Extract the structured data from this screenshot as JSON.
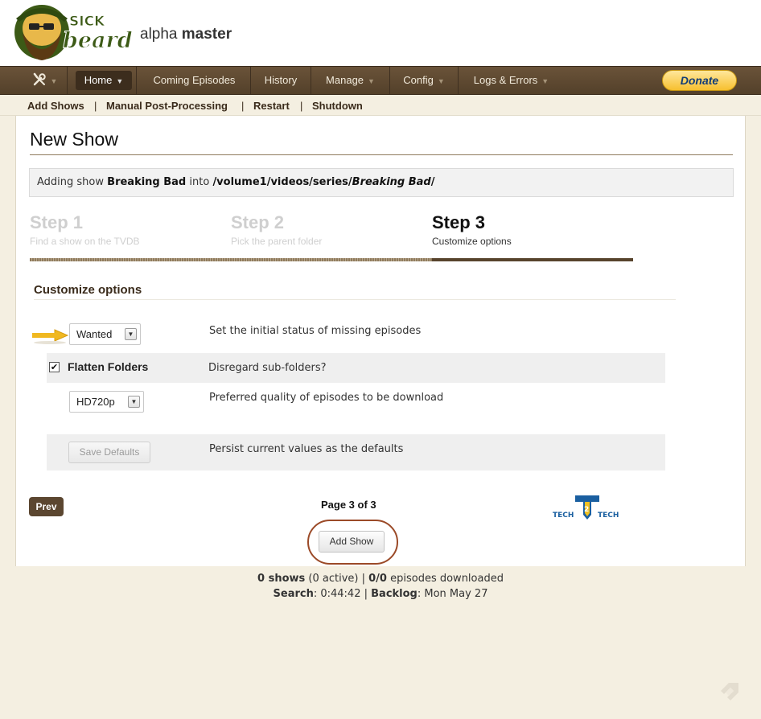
{
  "header": {
    "logo_text": "SICK beard",
    "version_prefix": "alpha",
    "version_branch": "master"
  },
  "nav": {
    "tools_icon": "wrench-screwdriver-icon",
    "items": [
      {
        "label": "Home",
        "has_dropdown": true,
        "active": true
      },
      {
        "label": "Coming Episodes",
        "has_dropdown": false
      },
      {
        "label": "History",
        "has_dropdown": false
      },
      {
        "label": "Manage",
        "has_dropdown": true
      },
      {
        "label": "Config",
        "has_dropdown": true
      },
      {
        "label": "Logs & Errors",
        "has_dropdown": true
      }
    ],
    "donate_label": "Donate"
  },
  "submenu": {
    "items": [
      "Add Shows",
      "Manual Post-Processing",
      "Restart",
      "Shutdown"
    ],
    "separator": "|"
  },
  "page": {
    "title": "New Show",
    "adding": {
      "prefix": "Adding show",
      "show_name": "Breaking Bad",
      "middle": "into",
      "path_base": "/volume1/videos/series/",
      "path_show": "Breaking Bad",
      "path_end": "/"
    },
    "steps": [
      {
        "title": "Step 1",
        "desc": "Find a show on the TVDB",
        "active": false
      },
      {
        "title": "Step 2",
        "desc": "Pick the parent folder",
        "active": false
      },
      {
        "title": "Step 3",
        "desc": "Customize options",
        "active": true
      }
    ],
    "section_title": "Customize options",
    "options": {
      "status": {
        "value": "Wanted",
        "desc": "Set the initial status of missing episodes"
      },
      "flatten": {
        "label": "Flatten Folders",
        "checked": true,
        "check_mark": "✔",
        "desc": "Disregard sub-folders?"
      },
      "quality": {
        "value": "HD720p",
        "desc": "Preferred quality of episodes to be download"
      },
      "save_defaults": {
        "label": "Save Defaults",
        "desc": "Persist current values as the defaults"
      }
    },
    "prev_label": "Prev",
    "page_indicator": "Page 3 of 3",
    "add_show_label": "Add Show",
    "watermark_text": "TECH 2 TECH"
  },
  "footer": {
    "shows_count": "0 shows",
    "active": "(0 active)",
    "episodes": "0/0",
    "episodes_suffix": "episodes downloaded",
    "search_label": "Search",
    "search_value": ": 0:44:42",
    "backlog_label": "Backlog",
    "backlog_value": ": Mon May 27"
  },
  "colors": {
    "nav_bg": "#5e482f",
    "accent_brown": "#57432c",
    "donate_yellow": "#f7c02f",
    "page_bg": "#f4efe1",
    "highlight_ring": "#9b4a28"
  }
}
